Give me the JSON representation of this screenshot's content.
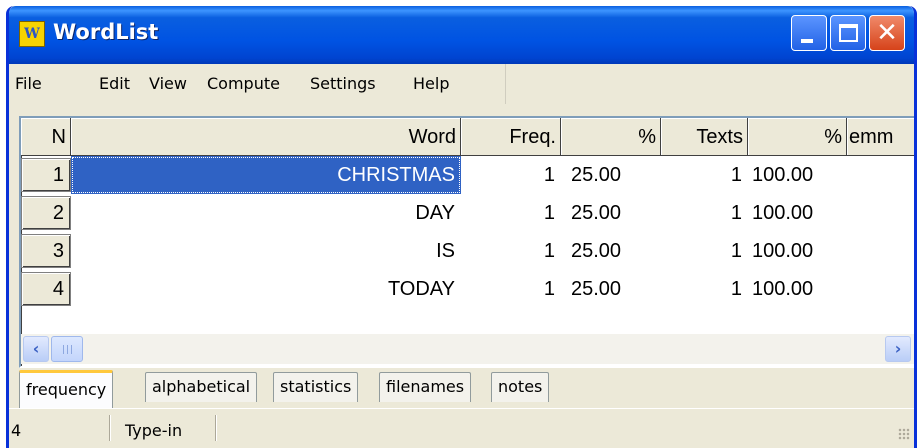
{
  "window": {
    "title": "WordList",
    "icon": "wordlist-app-icon"
  },
  "menu": [
    "File",
    "Edit",
    "View",
    "Compute",
    "Settings",
    "Help"
  ],
  "table": {
    "headers": {
      "n": "N",
      "word": "Word",
      "freq": "Freq.",
      "pct": "%",
      "texts": "Texts",
      "pct2": "%",
      "extra": "emm"
    },
    "rows": [
      {
        "n": "1",
        "word": "CHRISTMAS",
        "freq": "1",
        "pct": "25.00",
        "texts": "1",
        "pct2": "100.00"
      },
      {
        "n": "2",
        "word": "DAY",
        "freq": "1",
        "pct": "25.00",
        "texts": "1",
        "pct2": "100.00"
      },
      {
        "n": "3",
        "word": "IS",
        "freq": "1",
        "pct": "25.00",
        "texts": "1",
        "pct2": "100.00"
      },
      {
        "n": "4",
        "word": "TODAY",
        "freq": "1",
        "pct": "25.00",
        "texts": "1",
        "pct2": "100.00"
      }
    ],
    "selected_row": 0
  },
  "tabs": [
    "frequency",
    "alphabetical",
    "statistics",
    "filenames",
    "notes"
  ],
  "active_tab": "frequency",
  "status": {
    "count": "4",
    "mode": "Type-in"
  },
  "colors": {
    "titlebar": "#0053e3",
    "selection": "#2f62c4",
    "active_tab_accent": "#ffc83c"
  }
}
